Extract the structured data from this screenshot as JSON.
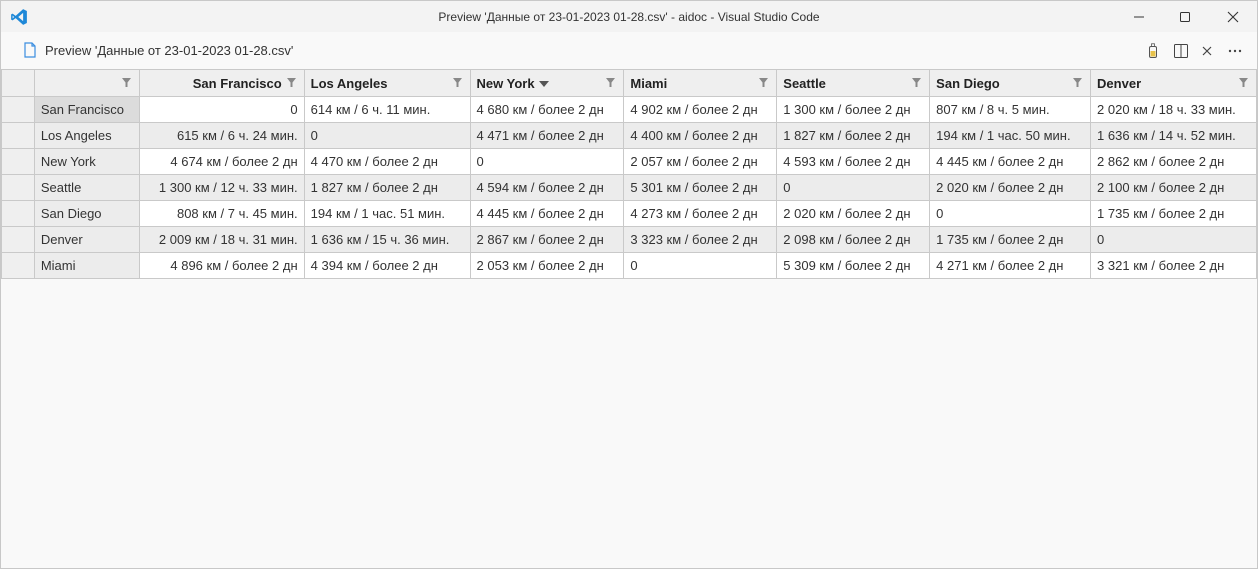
{
  "window": {
    "title": "Preview 'Данные от 23-01-2023 01-28.csv' - aidoc - Visual Studio Code"
  },
  "tab": {
    "title": "Preview 'Данные от 23-01-2023 01-28.csv'"
  },
  "grid": {
    "columns": [
      "",
      "San Francisco",
      "Los Angeles",
      "New York",
      "Miami",
      "Seattle",
      "San Diego",
      "Denver"
    ],
    "rows": [
      {
        "head": "San Francisco",
        "cells": [
          "0",
          "614 км / 6 ч. 11 мин.",
          "4 680 км / более 2 дн",
          "4 902 км / более 2 дн",
          "1 300 км / более 2 дн",
          "807 км / 8 ч. 5 мин.",
          "2 020 км / 18 ч. 33 мин."
        ]
      },
      {
        "head": "Los Angeles",
        "cells": [
          "615 км / 6 ч. 24 мин.",
          "0",
          "4 471 км / более 2 дн",
          "4 400 км / более 2 дн",
          "1 827 км / более 2 дн",
          "194 км / 1 час. 50 мин.",
          "1 636 км / 14 ч. 52 мин."
        ]
      },
      {
        "head": "New York",
        "cells": [
          "4 674 км / более 2 дн",
          "4 470 км / более 2 дн",
          "0",
          "2 057 км / более 2 дн",
          "4 593 км / более 2 дн",
          "4 445 км / более 2 дн",
          "2 862 км / более 2 дн"
        ]
      },
      {
        "head": "Seattle",
        "cells": [
          "1 300 км / 12 ч. 33 мин.",
          "1 827 км / более 2 дн",
          "4 594 км / более 2 дн",
          "5 301 км / более 2 дн",
          "0",
          "2 020 км / более 2 дн",
          "2 100 км / более 2 дн"
        ]
      },
      {
        "head": "San Diego",
        "cells": [
          "808 км / 7 ч. 45 мин.",
          "194 км / 1 час. 51 мин.",
          "4 445 км / более 2 дн",
          "4 273 км / более 2 дн",
          "2 020 км / более 2 дн",
          "0",
          "1 735 км / более 2 дн"
        ]
      },
      {
        "head": "Denver",
        "cells": [
          "2 009 км / 18 ч. 31 мин.",
          "1 636 км / 15 ч. 36 мин.",
          "2 867 км / более 2 дн",
          "3 323 км / более 2 дн",
          "2 098 км / более 2 дн",
          "1 735 км / более 2 дн",
          "0"
        ]
      },
      {
        "head": "Miami",
        "cells": [
          "4 896 км / более 2 дн",
          "4 394 км / более 2 дн",
          "2 053 км / более 2 дн",
          "0",
          "5 309 км / более 2 дн",
          "4 271 км / более 2 дн",
          "3 321 км / более 2 дн"
        ]
      }
    ]
  }
}
